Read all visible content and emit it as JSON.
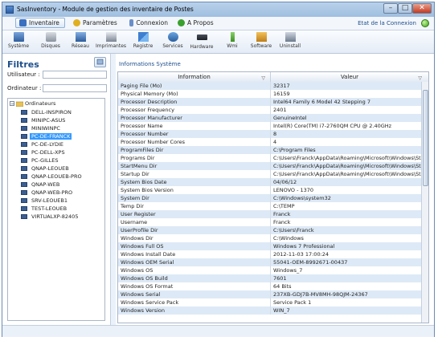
{
  "window": {
    "title": "SasInventory - Module de gestion des inventaire de Postes"
  },
  "menu": {
    "items": [
      {
        "label": "Inventaire",
        "icon": "inventory-icon"
      },
      {
        "label": "Paramètres",
        "icon": "settings-icon"
      },
      {
        "label": "Connexion",
        "icon": "connection-icon"
      },
      {
        "label": "A Propos",
        "icon": "about-icon"
      }
    ],
    "connection_state": "Etat de la Connexion"
  },
  "toolbar": {
    "items": [
      {
        "label": "Système",
        "icon": "system-icon"
      },
      {
        "label": "Disques",
        "icon": "disk-icon"
      },
      {
        "label": "Réseau",
        "icon": "network-icon"
      },
      {
        "label": "Imprimantes",
        "icon": "printer-icon"
      },
      {
        "label": "Registre",
        "icon": "registry-icon"
      },
      {
        "label": "Services",
        "icon": "services-icon"
      },
      {
        "label": "Hardware",
        "icon": "hardware-icon"
      },
      {
        "label": "Wmi",
        "icon": "wmi-icon"
      },
      {
        "label": "Software",
        "icon": "software-icon"
      },
      {
        "label": "Uninstall",
        "icon": "uninstall-icon"
      }
    ]
  },
  "filters": {
    "title": "Filtres",
    "user_label": "Utilisateur :",
    "user_value": "",
    "computer_label": "Ordinateur :",
    "computer_value": "",
    "tree_root": "Ordinateurs",
    "computers": [
      "DELL-INSPIRON",
      "MINIPC-ASUS",
      "MINIWINPC",
      "PC-DE-FRANCK",
      "PC-DE-LYDIE",
      "PC-DELL-XPS",
      "PC-GILLES",
      "QNAP-LEOUEB",
      "QNAP-LEOUEB-PRO",
      "QNAP-WEB",
      "QNAP-WEB-PRO",
      "SRV-LEOUEB1",
      "TEST-LEOUEB",
      "VIRTUALXP-82405"
    ],
    "selected_computer": "PC-DE-FRANCK"
  },
  "info": {
    "title": "Informations Système",
    "col_information": "Information",
    "col_value": "Valeur",
    "rows": [
      [
        "Paging File (Mo)",
        "32317"
      ],
      [
        "Physical Memory (Mo)",
        "16159"
      ],
      [
        "Processor Description",
        "Intel64 Family 6 Model 42 Stepping 7"
      ],
      [
        "Processor Frequency",
        "2401"
      ],
      [
        "Processor Manufacturer",
        "GenuineIntel"
      ],
      [
        "Processor Name",
        "Intel(R) Core(TM) i7-2760QM CPU @ 2.40GHz"
      ],
      [
        "Processor Number",
        "8"
      ],
      [
        "Processor Number Cores",
        "4"
      ],
      [
        "ProgramFiles Dir",
        "C:\\Program Files"
      ],
      [
        "Programs Dir",
        "C:\\Users\\Franck\\AppData\\Roaming\\Microsoft\\Windows\\Sta..."
      ],
      [
        "StartMenu Dir",
        "C:\\Users\\Franck\\AppData\\Roaming\\Microsoft\\Windows\\Sta..."
      ],
      [
        "Startup Dir",
        "C:\\Users\\Franck\\AppData\\Roaming\\Microsoft\\Windows\\Sta..."
      ],
      [
        "System Bios Date",
        "04/06/12"
      ],
      [
        "System Bios Version",
        "LENOVO - 1370"
      ],
      [
        "System Dir",
        "C:\\Windows\\system32"
      ],
      [
        "Temp Dir",
        "C:\\TEMP"
      ],
      [
        "User Register",
        "Franck"
      ],
      [
        "Username",
        "Franck"
      ],
      [
        "UserProfile Dir",
        "C:\\Users\\Franck"
      ],
      [
        "Windows Dir",
        "C:\\Windows"
      ],
      [
        "Windows Full OS",
        "Windows 7 Professional"
      ],
      [
        "Windows Install Date",
        "2012-11-03 17:00:24"
      ],
      [
        "Windows OEM Serial",
        "55041-OEM-8992671-00437"
      ],
      [
        "Windows OS",
        "Windows_7"
      ],
      [
        "Windows OS Build",
        "7601"
      ],
      [
        "Windows OS Format",
        "64 Bits"
      ],
      [
        "Windows Serial",
        "237XB-GDJ7B-MV8MH-98QJM-24367"
      ],
      [
        "Windows Service Pack",
        "Service Pack 1"
      ],
      [
        "Windows Version",
        "WIN_7"
      ]
    ]
  }
}
